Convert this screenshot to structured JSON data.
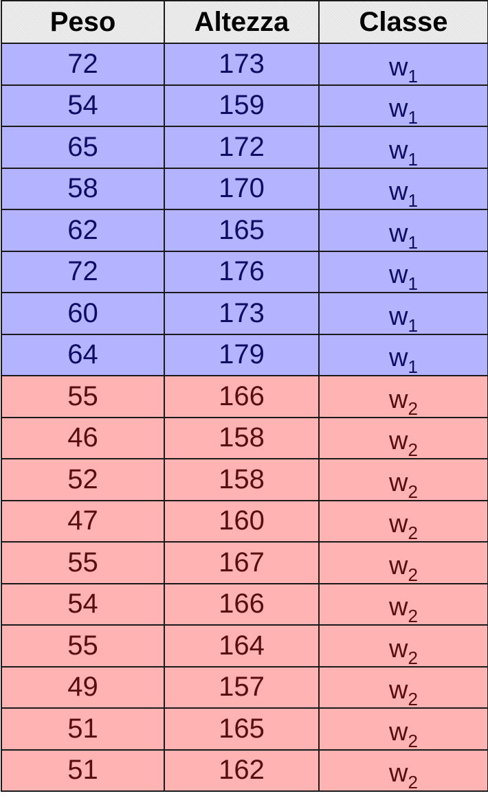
{
  "headers": [
    "Peso",
    "Altezza",
    "Classe"
  ],
  "colors": {
    "w1_row_bg": "#b3b3ff",
    "w1_text": "#0d0d66",
    "w2_row_bg": "#ffb3b3",
    "w2_text": "#5a0d0d",
    "header_bg": "#e6e6e6",
    "border": "#1a1a1a"
  },
  "rows": [
    {
      "peso": "72",
      "altezza": "173",
      "classe_base": "w",
      "classe_sub": "1"
    },
    {
      "peso": "54",
      "altezza": "159",
      "classe_base": "w",
      "classe_sub": "1"
    },
    {
      "peso": "65",
      "altezza": "172",
      "classe_base": "w",
      "classe_sub": "1"
    },
    {
      "peso": "58",
      "altezza": "170",
      "classe_base": "w",
      "classe_sub": "1"
    },
    {
      "peso": "62",
      "altezza": "165",
      "classe_base": "w",
      "classe_sub": "1"
    },
    {
      "peso": "72",
      "altezza": "176",
      "classe_base": "w",
      "classe_sub": "1"
    },
    {
      "peso": "60",
      "altezza": "173",
      "classe_base": "w",
      "classe_sub": "1"
    },
    {
      "peso": "64",
      "altezza": "179",
      "classe_base": "w",
      "classe_sub": "1"
    },
    {
      "peso": "55",
      "altezza": "166",
      "classe_base": "w",
      "classe_sub": "2"
    },
    {
      "peso": "46",
      "altezza": "158",
      "classe_base": "w",
      "classe_sub": "2"
    },
    {
      "peso": "52",
      "altezza": "158",
      "classe_base": "w",
      "classe_sub": "2"
    },
    {
      "peso": "47",
      "altezza": "160",
      "classe_base": "w",
      "classe_sub": "2"
    },
    {
      "peso": "55",
      "altezza": "167",
      "classe_base": "w",
      "classe_sub": "2"
    },
    {
      "peso": "54",
      "altezza": "166",
      "classe_base": "w",
      "classe_sub": "2"
    },
    {
      "peso": "55",
      "altezza": "164",
      "classe_base": "w",
      "classe_sub": "2"
    },
    {
      "peso": "49",
      "altezza": "157",
      "classe_base": "w",
      "classe_sub": "2"
    },
    {
      "peso": "51",
      "altezza": "165",
      "classe_base": "w",
      "classe_sub": "2"
    },
    {
      "peso": "51",
      "altezza": "162",
      "classe_base": "w",
      "classe_sub": "2"
    }
  ]
}
